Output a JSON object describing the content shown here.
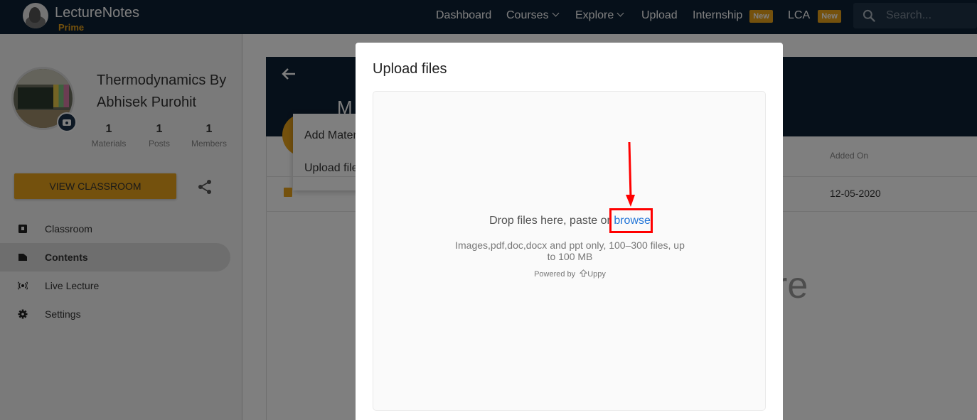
{
  "navbar": {
    "brand": "LectureNotes",
    "brand_sub": "Prime",
    "items": {
      "dashboard": "Dashboard",
      "courses": "Courses",
      "explore": "Explore",
      "upload": "Upload",
      "internship": "Internship",
      "lca": "LCA"
    },
    "new_badge": "New",
    "search_placeholder": "Search..."
  },
  "sidebar": {
    "class_title": "Thermodynamics By Abhisek Purohit",
    "stats": [
      {
        "value": "1",
        "label": "Materials"
      },
      {
        "value": "1",
        "label": "Posts"
      },
      {
        "value": "1",
        "label": "Members"
      }
    ],
    "view_button": "VIEW CLASSROOM",
    "menu": [
      {
        "label": "Classroom",
        "icon": "classroom-icon"
      },
      {
        "label": "Contents",
        "icon": "contents-icon",
        "active": true
      },
      {
        "label": "Live Lecture",
        "icon": "live-lecture-icon"
      },
      {
        "label": "Settings",
        "icon": "settings-icon"
      }
    ]
  },
  "content": {
    "header_letter": "M",
    "popup_menu": [
      "Add Material",
      "Upload files"
    ],
    "column_added_on": "Added On",
    "rows": [
      {
        "date": "12-05-2020"
      }
    ],
    "background_text": "re"
  },
  "modal": {
    "title": "Upload files",
    "drop_text": "Drop files here, paste or ",
    "browse_label": "browse",
    "hint": "Images,pdf,doc,docx and ppt only, 100–300 files, up to 100 MB",
    "powered_by": "Powered by",
    "uppy_label": "Uppy"
  },
  "colors": {
    "navy": "#0d2034",
    "accent": "#e8a21a",
    "link": "#2275d7",
    "annotation": "#ff0000"
  }
}
